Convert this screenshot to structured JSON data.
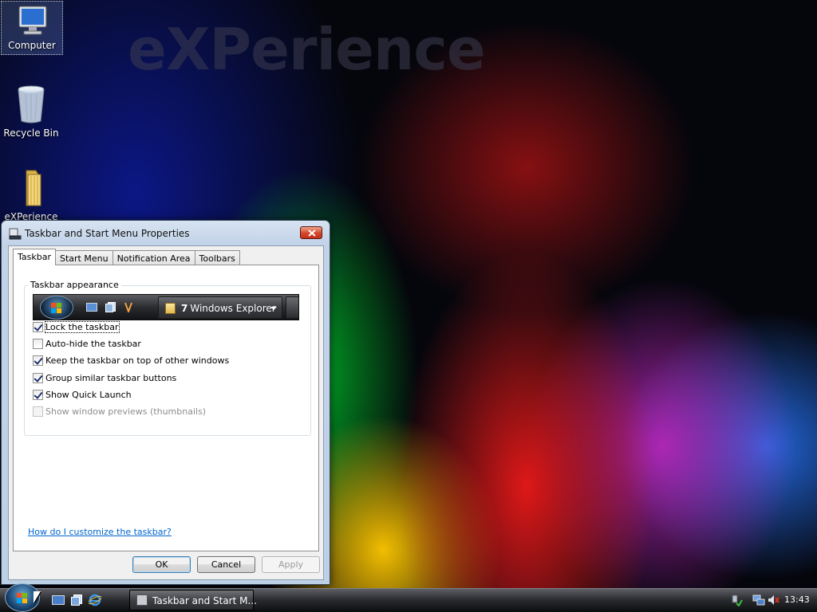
{
  "desktop": {
    "watermark": "eXPerience",
    "icons": [
      {
        "label": "Computer",
        "icon": "computer-icon"
      },
      {
        "label": "Recycle Bin",
        "icon": "recycle-bin-icon"
      },
      {
        "label": "eXPerience",
        "icon": "folder-icon"
      }
    ]
  },
  "dialog": {
    "title": "Taskbar and Start Menu Properties",
    "tabs": [
      {
        "label": "Taskbar",
        "active": true
      },
      {
        "label": "Start Menu"
      },
      {
        "label": "Notification Area"
      },
      {
        "label": "Toolbars"
      }
    ],
    "group_label": "Taskbar appearance",
    "preview": {
      "task_count": "7",
      "task_label": "Windows Explorer"
    },
    "checkboxes": [
      {
        "label": "Lock the taskbar",
        "checked": true
      },
      {
        "label": "Auto-hide the taskbar",
        "checked": false
      },
      {
        "label": "Keep the taskbar on top of other windows",
        "checked": true
      },
      {
        "label": "Group similar taskbar buttons",
        "checked": true
      },
      {
        "label": "Show Quick Launch",
        "checked": true
      },
      {
        "label": "Show window previews (thumbnails)",
        "checked": false,
        "disabled": true
      }
    ],
    "help_link": "How do I customize the taskbar?",
    "buttons": {
      "ok": "OK",
      "cancel": "Cancel",
      "apply": "Apply"
    }
  },
  "taskbar": {
    "task_label": "Taskbar and Start M...",
    "clock": "13:43"
  }
}
